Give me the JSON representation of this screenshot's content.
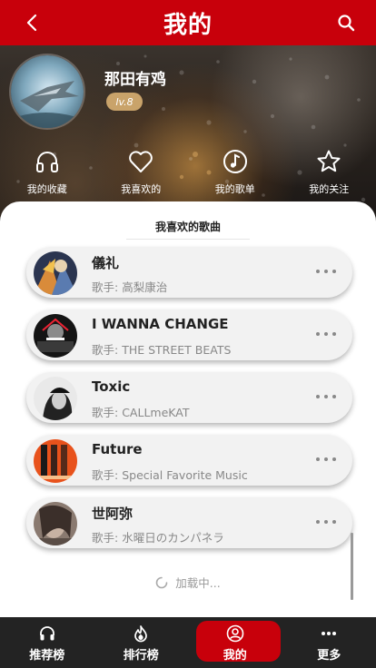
{
  "header": {
    "title": "我的",
    "back_icon": "chevron-left-icon",
    "search_icon": "search-icon",
    "bg_color": "#c8000b"
  },
  "profile": {
    "username": "那田有鸡",
    "level": "lv.8"
  },
  "quick_links": [
    {
      "label": "我的收藏",
      "icon": "headphones-icon"
    },
    {
      "label": "我喜欢的",
      "icon": "heart-icon"
    },
    {
      "label": "我的歌单",
      "icon": "music-note-icon"
    },
    {
      "label": "我的关注",
      "icon": "star-icon"
    }
  ],
  "favorites": {
    "title": "我喜欢的歌曲",
    "artist_prefix": "歌手:",
    "songs": [
      {
        "name": "儀礼",
        "artist": "高梨康治"
      },
      {
        "name": "I WANNA CHANGE",
        "artist": "THE STREET BEATS"
      },
      {
        "name": "Toxic",
        "artist": "CALLmeKAT"
      },
      {
        "name": "Future",
        "artist": "Special Favorite Music"
      },
      {
        "name": "世阿弥",
        "artist": "水曜日のカンパネラ"
      }
    ],
    "loading_text": "加载中..."
  },
  "bottom_nav": {
    "tabs": [
      {
        "label": "推荐榜",
        "icon": "headphones-icon",
        "active": false
      },
      {
        "label": "排行榜",
        "icon": "flame-icon",
        "active": false
      },
      {
        "label": "我的",
        "icon": "user-icon",
        "active": true
      },
      {
        "label": "更多",
        "icon": "more-dots-icon",
        "active": false
      }
    ],
    "active_color": "#c8000b"
  }
}
